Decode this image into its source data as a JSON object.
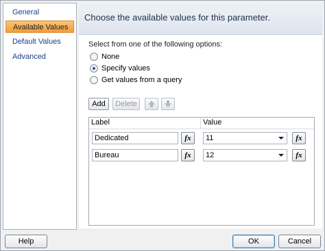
{
  "nav": {
    "items": [
      {
        "label": "General"
      },
      {
        "label": "Available Values"
      },
      {
        "label": "Default Values"
      },
      {
        "label": "Advanced"
      }
    ],
    "active_index": 1
  },
  "banner": {
    "title": "Choose the available values for this parameter."
  },
  "options": {
    "instruction": "Select from one of the following options:",
    "choices": [
      {
        "label": "None",
        "selected": false
      },
      {
        "label": "Specify values",
        "selected": true
      },
      {
        "label": "Get values from a query",
        "selected": false
      }
    ]
  },
  "toolbar": {
    "add_label": "Add",
    "delete_label": "Delete",
    "move_up_icon": "arrow-up-icon",
    "move_down_icon": "arrow-down-icon"
  },
  "grid": {
    "columns": [
      "Label",
      "Value"
    ],
    "rows": [
      {
        "label": "Dedicated",
        "value": "11"
      },
      {
        "label": "Bureau",
        "value": "12"
      }
    ],
    "expression_glyph": "fx"
  },
  "footer": {
    "help_label": "Help",
    "ok_label": "OK",
    "cancel_label": "Cancel"
  },
  "colors": {
    "accent": "#f29b3a",
    "link": "#1a3d8f",
    "radio_selected": "#1b58b8"
  }
}
